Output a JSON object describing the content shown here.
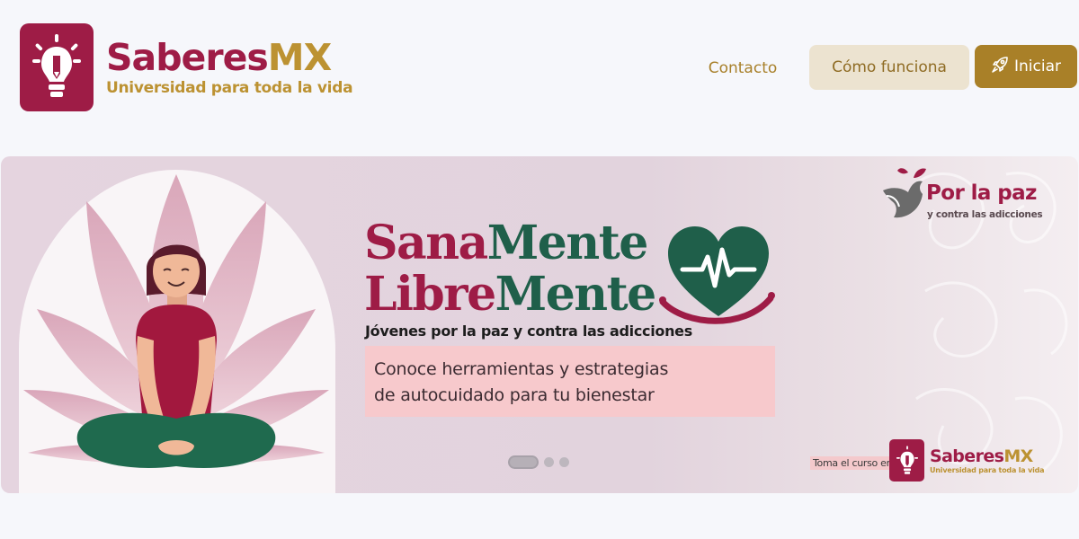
{
  "header": {
    "brand_part1": "Saberes",
    "brand_part2": "MX",
    "tagline": "Universidad para toda la vida",
    "nav": {
      "contact_label": "Contacto",
      "how_it_works_label": "Cómo funciona",
      "start_label": "Iniciar"
    }
  },
  "banner": {
    "title_line1_a": "Sana",
    "title_line1_b": "Mente",
    "title_line2_a": "Libre",
    "title_line2_b": "Mente",
    "subtitle": "Jóvenes por la paz y contra las adicciones",
    "description_line1": "Conoce herramientas y estrategias",
    "description_line2": "de autocuidado para tu bienestar",
    "campaign_title": "Por la paz",
    "campaign_subtitle": "y contra las adicciones",
    "take_course_label": "Toma el curso en:",
    "mini_brand_part1": "Saberes",
    "mini_brand_part2": "MX",
    "mini_tagline": "Universidad para toda la vida",
    "carousel": {
      "slides": 3,
      "active_index": 1
    }
  },
  "colors": {
    "brand_red": "#9e1c46",
    "brand_gold": "#bc9232",
    "brand_green": "#1f5f4a",
    "page_background": "#f6f7fb",
    "button_light": "#ece3d0",
    "button_dark": "#a98028"
  },
  "icons": {
    "logo": "lightbulb-pencil-icon",
    "start_button": "rocket-icon",
    "heart": "heart-pulse-icon",
    "campaign": "dove-icon"
  }
}
